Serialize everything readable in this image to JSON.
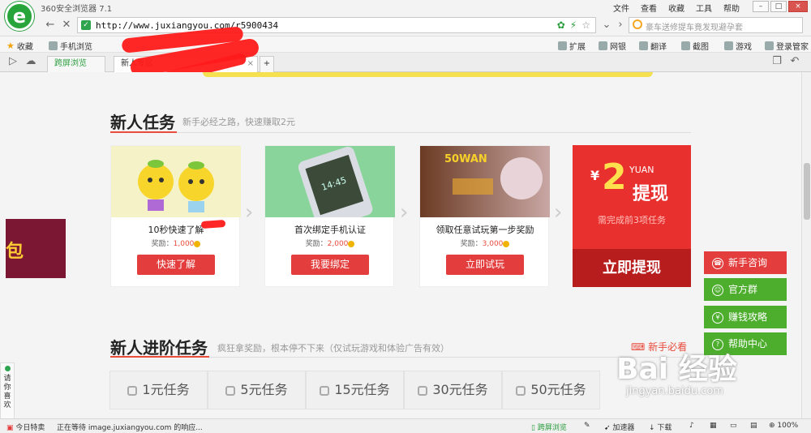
{
  "browser": {
    "app_title": "360安全浏览器 7.1",
    "menu": [
      "文件",
      "查看",
      "收藏",
      "工具",
      "帮助"
    ],
    "window_buttons": [
      "–",
      "□",
      "×"
    ],
    "url": "http://www.juxiangyou.com/r5900434",
    "search_placeholder": "豪车送修提车竟发现避孕套",
    "favorites_label": "收藏",
    "favorites_item": "手机浏览",
    "toolbar_items": [
      "扩展",
      "网银",
      "翻译",
      "截图",
      "游戏",
      "登录管家"
    ],
    "tabs": [
      "跨屏浏览",
      "新人专区"
    ],
    "tab_add": "+"
  },
  "section1": {
    "title": "新人任务",
    "subtitle": "新手必经之路，快速赚取2元",
    "cards": [
      {
        "name": "10秒快速了解",
        "reward_label": "奖励：",
        "reward_value": "1,000",
        "button": "快速了解"
      },
      {
        "name": "首次绑定手机认证",
        "reward_label": "奖励：",
        "reward_value": "2,000",
        "button": "我要绑定"
      },
      {
        "name": "领取任意试玩第一步奖励",
        "reward_label": "奖励：",
        "reward_value": "3,000",
        "button": "立即试玩"
      }
    ],
    "card_images": [
      "14:45",
      "50WAN"
    ],
    "withdraw": {
      "symbol": "¥",
      "amount": "2",
      "unit": "YUAN",
      "word": "提现",
      "need": "需完成前3项任务",
      "button": "立即提现"
    }
  },
  "section2": {
    "title": "新人进阶任务",
    "subtitle": "疯狂拿奖励，根本停不下来（仅试玩游戏和体验广告有效）",
    "help_link": "新手必看",
    "tabs": [
      "1元任务",
      "5元任务",
      "15元任务",
      "30元任务",
      "50元任务"
    ]
  },
  "float_menu": [
    "新手咨询",
    "官方群",
    "赚钱攻略",
    "帮助中心"
  ],
  "left_float": "请你喜欢",
  "side_widget_char": "包",
  "watermark": {
    "main": "Bai 经验",
    "sub": "jingyan.baidu.com"
  },
  "status": {
    "today": "今日特卖",
    "loading": "正在等待 image.juxiangyou.com 的响应...",
    "cross_screen": "跨屏浏览",
    "accelerator": "加速器",
    "download": "下载",
    "zoom": "100%"
  },
  "colors": {
    "accent_red": "#e33d3d",
    "accent_green": "#4cae2c",
    "coin": "#f0b400"
  }
}
